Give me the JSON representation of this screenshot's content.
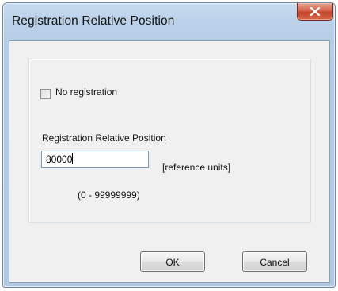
{
  "window": {
    "title": "Registration Relative Position",
    "close_icon": "close-icon"
  },
  "form": {
    "checkbox_label": "No registration",
    "checkbox_checked": false,
    "field_label": "Registration Relative Position",
    "field_value": "80000",
    "units": "[reference units]",
    "range": "(0 - 99999999)"
  },
  "buttons": {
    "ok": "OK",
    "cancel": "Cancel"
  },
  "colors": {
    "close_button": "#c9452c",
    "frame": "#b9cfe7"
  }
}
